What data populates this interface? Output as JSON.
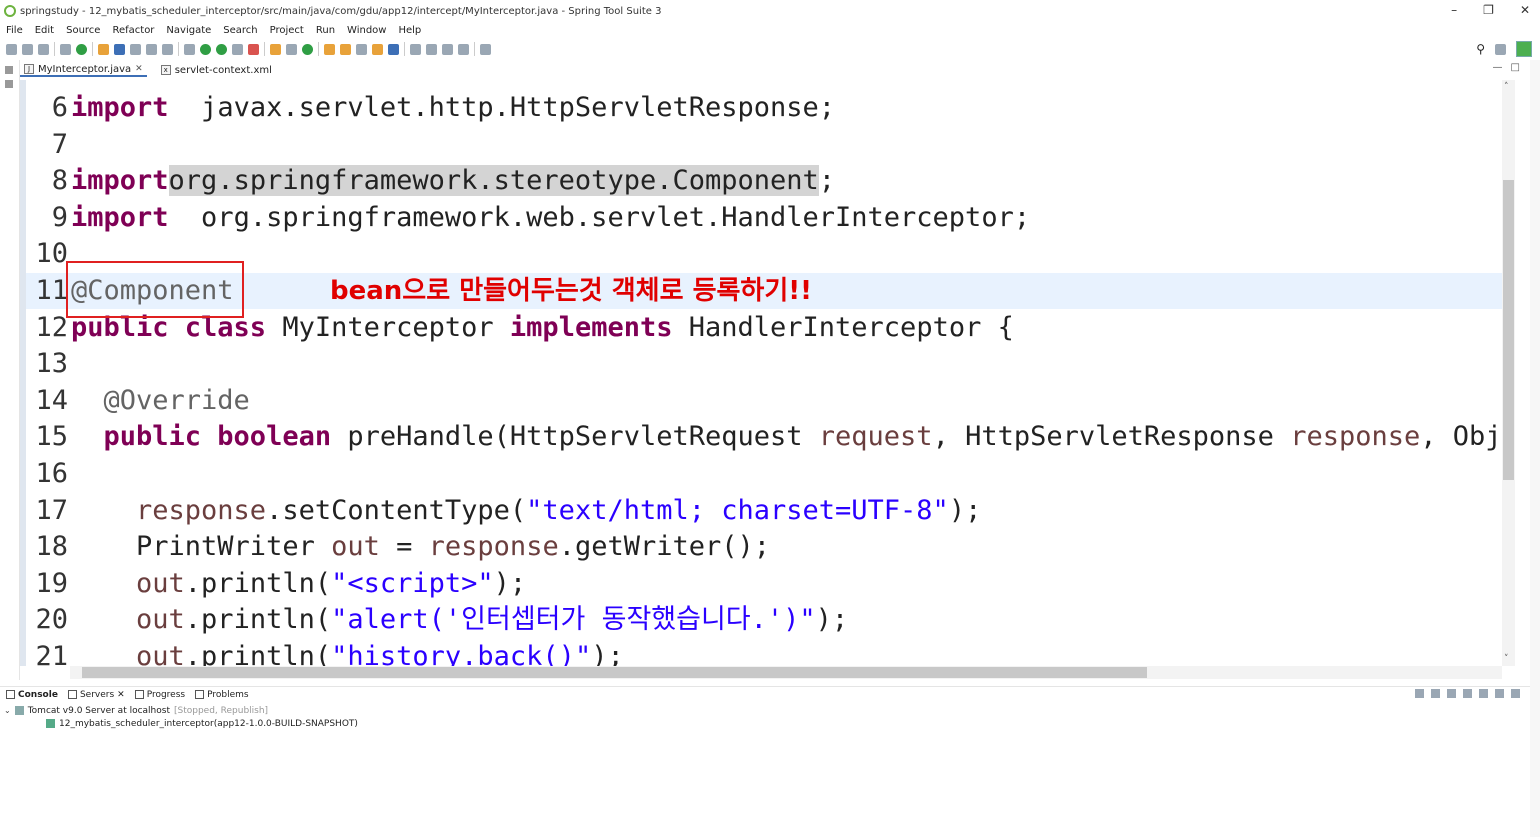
{
  "window": {
    "title": "springstudy - 12_mybatis_scheduler_interceptor/src/main/java/com/gdu/app12/intercept/MyInterceptor.java - Spring Tool Suite 3",
    "minimize": "–",
    "maximize": "❐",
    "close": "✕"
  },
  "menu": [
    "File",
    "Edit",
    "Source",
    "Refactor",
    "Navigate",
    "Search",
    "Project",
    "Run",
    "Window",
    "Help"
  ],
  "editor_tabs": [
    {
      "label": "MyInterceptor.java",
      "close": "✕",
      "active": true
    },
    {
      "label": "servlet-context.xml",
      "active": false
    }
  ],
  "code_lines": [
    {
      "num": "6",
      "parts": [
        [
          "kw",
          "import"
        ],
        [
          "",
          "  javax.servlet.http.HttpServletResponse;"
        ]
      ]
    },
    {
      "num": "7",
      "parts": []
    },
    {
      "num": "8",
      "parts": [
        [
          "kw",
          "import"
        ],
        [
          "",
          ""
        ],
        [
          "hl",
          "org.springframework.stereotype.Component"
        ],
        [
          "",
          ";"
        ]
      ]
    },
    {
      "num": "9",
      "parts": [
        [
          "kw",
          "import"
        ],
        [
          "",
          "  org.springframework.web.servlet.HandlerInterceptor;"
        ]
      ]
    },
    {
      "num": "10",
      "parts": []
    },
    {
      "num": "11",
      "parts": [
        [
          "anno",
          "@Component"
        ]
      ]
    },
    {
      "num": "12",
      "parts": [
        [
          "kw",
          "public class"
        ],
        [
          "",
          " MyInterceptor "
        ],
        [
          "kw",
          "implements"
        ],
        [
          "",
          " HandlerInterceptor {"
        ]
      ]
    },
    {
      "num": "13",
      "parts": []
    },
    {
      "num": "14",
      "parts": [
        [
          "anno",
          "  @Override"
        ]
      ]
    },
    {
      "num": "15",
      "parts": [
        [
          "kw",
          "  public boolean"
        ],
        [
          "",
          " preHandle(HttpServletRequest "
        ],
        [
          "var",
          "request"
        ],
        [
          "",
          ", HttpServletResponse "
        ],
        [
          "var",
          "response"
        ],
        [
          "",
          ", Objec"
        ]
      ]
    },
    {
      "num": "16",
      "parts": []
    },
    {
      "num": "17",
      "parts": [
        [
          "var",
          "    response"
        ],
        [
          "",
          ".setContentType("
        ],
        [
          "str",
          "\"text/html; charset=UTF-8\""
        ],
        [
          "",
          ");"
        ]
      ]
    },
    {
      "num": "18",
      "parts": [
        [
          "",
          "    PrintWriter "
        ],
        [
          "var",
          "out"
        ],
        [
          "",
          " = "
        ],
        [
          "var",
          "response"
        ],
        [
          "",
          ".getWriter();"
        ]
      ]
    },
    {
      "num": "19",
      "parts": [
        [
          "var",
          "    out"
        ],
        [
          "",
          ".println("
        ],
        [
          "str",
          "\"<script>\""
        ],
        [
          "",
          ");"
        ]
      ]
    },
    {
      "num": "20",
      "parts": [
        [
          "var",
          "    out"
        ],
        [
          "",
          ".println("
        ],
        [
          "str",
          "\"alert('인터셉터가 동작했습니다.')\""
        ],
        [
          "",
          ");"
        ]
      ]
    },
    {
      "num": "21",
      "parts": [
        [
          "var",
          "    out"
        ],
        [
          "",
          ".println("
        ],
        [
          "str",
          "\"history.back()\""
        ],
        [
          "",
          ");"
        ]
      ]
    }
  ],
  "annotation": {
    "text": "bean으로 만들어두는것 객체로 등록하기!!",
    "color": "#e00000"
  },
  "bottom_tabs": [
    {
      "label": "Console",
      "active": true
    },
    {
      "label": "Servers",
      "close": "✕",
      "active": false
    },
    {
      "label": "Progress",
      "active": false
    },
    {
      "label": "Problems",
      "active": false
    }
  ],
  "servers": {
    "server_name": "Tomcat v9.0 Server at localhost",
    "server_status": "[Stopped, Republish]",
    "module": "12_mybatis_scheduler_interceptor(app12-1.0.0-BUILD-SNAPSHOT)"
  },
  "colors": {
    "keyword": "#7f0055",
    "string": "#2a00ff",
    "variable": "#6a3e3e",
    "annotation": "#646464",
    "current_line": "#e8f2fe"
  }
}
